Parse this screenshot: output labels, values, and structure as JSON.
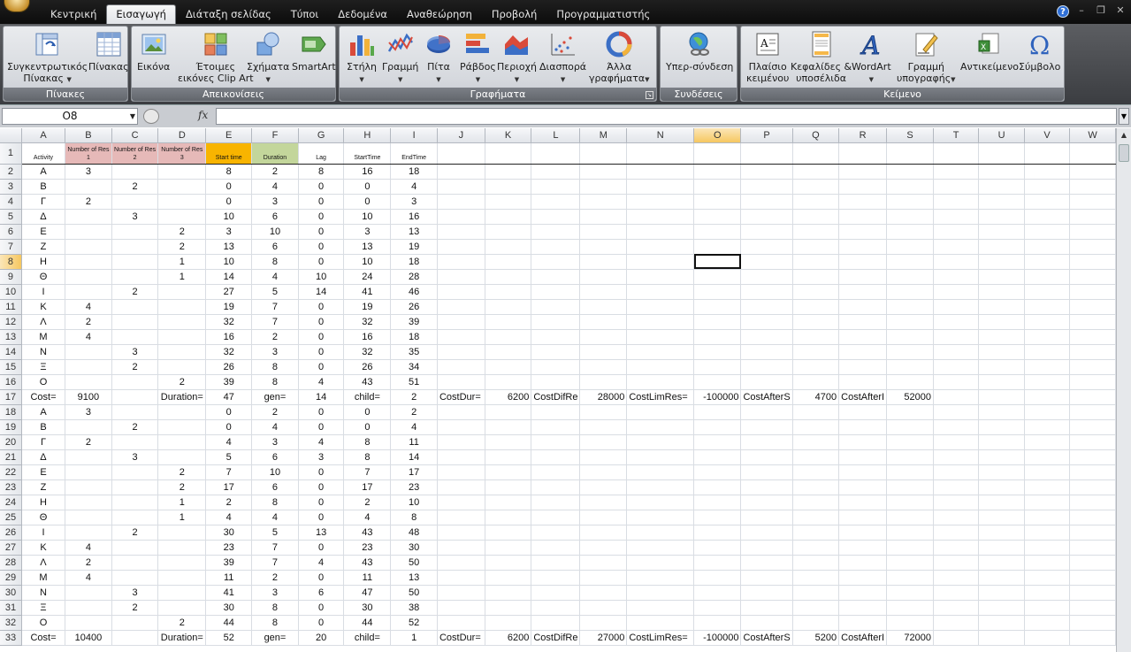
{
  "tabs": [
    "Κεντρική",
    "Εισαγωγή",
    "Διάταξη σελίδας",
    "Τύποι",
    "Δεδομένα",
    "Αναθεώρηση",
    "Προβολή",
    "Προγραμματιστής"
  ],
  "active_tab": "Εισαγωγή",
  "ribbon": {
    "groups": [
      {
        "label": "Πίνακες",
        "buttons": [
          {
            "label": "Συγκεντρωτικός\nΠίνακας",
            "icon": "pivot-table-icon",
            "dropdown": true
          },
          {
            "label": "Πίνακας",
            "icon": "table-icon",
            "dropdown": false
          }
        ]
      },
      {
        "label": "Απεικονίσεις",
        "buttons": [
          {
            "label": "Εικόνα",
            "icon": "picture-icon",
            "dropdown": false
          },
          {
            "label": "Έτοιμες\nεικόνες Clip Art",
            "icon": "clip-art-icon",
            "dropdown": false
          },
          {
            "label": "Σχήματα",
            "icon": "shapes-icon",
            "dropdown": true
          },
          {
            "label": "SmartArt",
            "icon": "smartart-icon",
            "dropdown": false
          }
        ]
      },
      {
        "label": "Γραφήματα",
        "buttons": [
          {
            "label": "Στήλη",
            "icon": "column-chart-icon",
            "dropdown": true
          },
          {
            "label": "Γραμμή",
            "icon": "line-chart-icon",
            "dropdown": true
          },
          {
            "label": "Πίτα",
            "icon": "pie-chart-icon",
            "dropdown": true
          },
          {
            "label": "Ράβδος",
            "icon": "bar-chart-icon",
            "dropdown": true
          },
          {
            "label": "Περιοχή",
            "icon": "area-chart-icon",
            "dropdown": true
          },
          {
            "label": "Διασπορά",
            "icon": "scatter-chart-icon",
            "dropdown": true
          },
          {
            "label": "Άλλα\nγραφήματα",
            "icon": "other-charts-icon",
            "dropdown": true
          }
        ]
      },
      {
        "label": "Συνδέσεις",
        "buttons": [
          {
            "label": "Υπερ-σύνδεση",
            "icon": "hyperlink-icon",
            "dropdown": false
          }
        ]
      },
      {
        "label": "Κείμενο",
        "buttons": [
          {
            "label": "Πλαίσιο\nκειμένου",
            "icon": "text-box-icon",
            "dropdown": false
          },
          {
            "label": "Κεφαλίδες &\nυποσέλιδα",
            "icon": "header-footer-icon",
            "dropdown": false
          },
          {
            "label": "WordArt",
            "icon": "wordart-icon",
            "dropdown": true
          },
          {
            "label": "Γραμμή\nυπογραφής",
            "icon": "signature-line-icon",
            "dropdown": true
          },
          {
            "label": "Αντικείμενο",
            "icon": "object-icon",
            "dropdown": false
          },
          {
            "label": "Σύμβολο",
            "icon": "symbol-icon",
            "dropdown": false
          }
        ]
      }
    ]
  },
  "formula_bar": {
    "name_box": "O8",
    "fx": "fx",
    "formula": ""
  },
  "sheet": {
    "columns": [
      "A",
      "B",
      "C",
      "D",
      "E",
      "F",
      "G",
      "H",
      "I",
      "J",
      "K",
      "L",
      "M",
      "N",
      "O",
      "P",
      "Q",
      "R",
      "S",
      "T",
      "U",
      "V",
      "W"
    ],
    "selected_column": "O",
    "selected_row": 8,
    "selected_cell": "O8",
    "header_row": [
      "Activity",
      "Number of Res 1",
      "Number of Res 2",
      "Number of Res 3",
      "Start time",
      "Duration",
      "Lag",
      "StartTime",
      "EndTime"
    ],
    "rows": [
      {
        "n": 2,
        "cells": [
          "A",
          "3",
          "",
          "",
          "8",
          "2",
          "8",
          "16",
          "18"
        ]
      },
      {
        "n": 3,
        "cells": [
          "B",
          "",
          "2",
          "",
          "0",
          "4",
          "0",
          "0",
          "4"
        ]
      },
      {
        "n": 4,
        "cells": [
          "Γ",
          "2",
          "",
          "",
          "0",
          "3",
          "0",
          "0",
          "3"
        ]
      },
      {
        "n": 5,
        "cells": [
          "Δ",
          "",
          "3",
          "",
          "10",
          "6",
          "0",
          "10",
          "16"
        ]
      },
      {
        "n": 6,
        "cells": [
          "E",
          "",
          "",
          "2",
          "3",
          "10",
          "0",
          "3",
          "13"
        ]
      },
      {
        "n": 7,
        "cells": [
          "Z",
          "",
          "",
          "2",
          "13",
          "6",
          "0",
          "13",
          "19"
        ]
      },
      {
        "n": 8,
        "cells": [
          "H",
          "",
          "",
          "1",
          "10",
          "8",
          "0",
          "10",
          "18"
        ]
      },
      {
        "n": 9,
        "cells": [
          "Θ",
          "",
          "",
          "1",
          "14",
          "4",
          "10",
          "24",
          "28"
        ]
      },
      {
        "n": 10,
        "cells": [
          "I",
          "",
          "2",
          "",
          "27",
          "5",
          "14",
          "41",
          "46"
        ]
      },
      {
        "n": 11,
        "cells": [
          "K",
          "4",
          "",
          "",
          "19",
          "7",
          "0",
          "19",
          "26"
        ]
      },
      {
        "n": 12,
        "cells": [
          "Λ",
          "2",
          "",
          "",
          "32",
          "7",
          "0",
          "32",
          "39"
        ]
      },
      {
        "n": 13,
        "cells": [
          "M",
          "4",
          "",
          "",
          "16",
          "2",
          "0",
          "16",
          "18"
        ]
      },
      {
        "n": 14,
        "cells": [
          "N",
          "",
          "3",
          "",
          "32",
          "3",
          "0",
          "32",
          "35"
        ]
      },
      {
        "n": 15,
        "cells": [
          "Ξ",
          "",
          "2",
          "",
          "26",
          "8",
          "0",
          "26",
          "34"
        ]
      },
      {
        "n": 16,
        "cells": [
          "O",
          "",
          "",
          "2",
          "39",
          "8",
          "4",
          "43",
          "51"
        ]
      },
      {
        "n": 17,
        "summary": true,
        "cells": [
          "Cost=",
          "9100",
          "",
          "Duration=",
          "47",
          "gen=",
          "14",
          "child=",
          "2",
          "CostDur=",
          "6200",
          "CostDifRe",
          "28000",
          "CostLimRes=",
          "-100000",
          "CostAfterS",
          "4700",
          "CostAfterI",
          "52000"
        ]
      },
      {
        "n": 18,
        "cells": [
          "A",
          "3",
          "",
          "",
          "0",
          "2",
          "0",
          "0",
          "2"
        ]
      },
      {
        "n": 19,
        "cells": [
          "B",
          "",
          "2",
          "",
          "0",
          "4",
          "0",
          "0",
          "4"
        ]
      },
      {
        "n": 20,
        "cells": [
          "Γ",
          "2",
          "",
          "",
          "4",
          "3",
          "4",
          "8",
          "11"
        ]
      },
      {
        "n": 21,
        "cells": [
          "Δ",
          "",
          "3",
          "",
          "5",
          "6",
          "3",
          "8",
          "14"
        ]
      },
      {
        "n": 22,
        "cells": [
          "E",
          "",
          "",
          "2",
          "7",
          "10",
          "0",
          "7",
          "17"
        ]
      },
      {
        "n": 23,
        "cells": [
          "Z",
          "",
          "",
          "2",
          "17",
          "6",
          "0",
          "17",
          "23"
        ]
      },
      {
        "n": 24,
        "cells": [
          "H",
          "",
          "",
          "1",
          "2",
          "8",
          "0",
          "2",
          "10"
        ]
      },
      {
        "n": 25,
        "cells": [
          "Θ",
          "",
          "",
          "1",
          "4",
          "4",
          "0",
          "4",
          "8"
        ]
      },
      {
        "n": 26,
        "cells": [
          "I",
          "",
          "2",
          "",
          "30",
          "5",
          "13",
          "43",
          "48"
        ]
      },
      {
        "n": 27,
        "cells": [
          "K",
          "4",
          "",
          "",
          "23",
          "7",
          "0",
          "23",
          "30"
        ]
      },
      {
        "n": 28,
        "cells": [
          "Λ",
          "2",
          "",
          "",
          "39",
          "7",
          "4",
          "43",
          "50"
        ]
      },
      {
        "n": 29,
        "cells": [
          "M",
          "4",
          "",
          "",
          "11",
          "2",
          "0",
          "11",
          "13"
        ]
      },
      {
        "n": 30,
        "cells": [
          "N",
          "",
          "3",
          "",
          "41",
          "3",
          "6",
          "47",
          "50"
        ]
      },
      {
        "n": 31,
        "cells": [
          "Ξ",
          "",
          "2",
          "",
          "30",
          "8",
          "0",
          "30",
          "38"
        ]
      },
      {
        "n": 32,
        "cells": [
          "O",
          "",
          "",
          "2",
          "44",
          "8",
          "0",
          "44",
          "52"
        ]
      },
      {
        "n": 33,
        "summary": true,
        "cells": [
          "Cost=",
          "10400",
          "",
          "Duration=",
          "52",
          "gen=",
          "20",
          "child=",
          "1",
          "CostDur=",
          "6200",
          "CostDifRe",
          "27000",
          "CostLimRes=",
          "-100000",
          "CostAfterS",
          "5200",
          "CostAfterI",
          "72000"
        ]
      }
    ]
  },
  "colors": {
    "header_red": "#e6b9b8",
    "header_orange": "#f8b400",
    "header_green": "#c3d69b",
    "selection": "#f6c760"
  }
}
